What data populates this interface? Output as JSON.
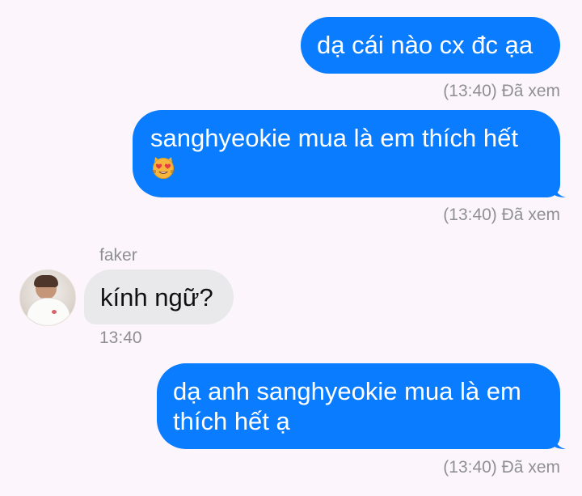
{
  "messages": [
    {
      "text": "dạ cái nào cx đc ạa",
      "status": "(13:40) Đã xem"
    },
    {
      "text": "sanghyeokie mua là em thích hết",
      "emoji": "😻",
      "status": "(13:40) Đã xem"
    },
    {
      "sender": "faker",
      "text": "kính ngữ?",
      "time": "13:40"
    },
    {
      "text_line1": "dạ anh sanghyeokie mua là em",
      "text_line2": "thích hết ạ",
      "status": "(13:40) Đã xem"
    }
  ],
  "colors": {
    "outgoing_bubble": "#0a7cff",
    "incoming_bubble": "#e9e9ec",
    "background": "#fcf6fc",
    "meta_text": "#8f8f95"
  }
}
